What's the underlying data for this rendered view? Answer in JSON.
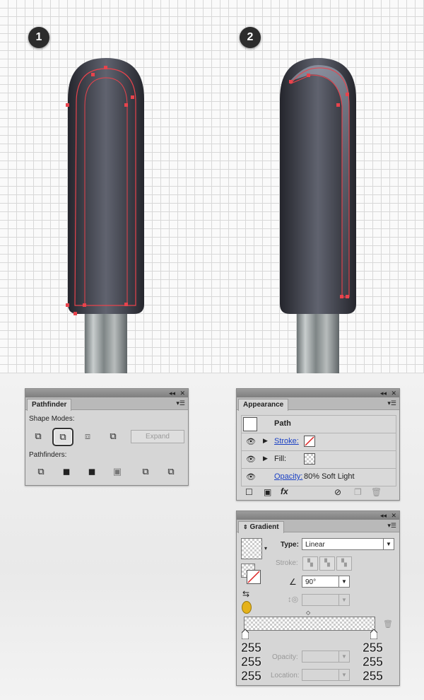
{
  "steps": {
    "step1": "1",
    "step2": "2"
  },
  "pathfinder": {
    "tab": "Pathfinder",
    "shape_modes_label": "Shape Modes:",
    "expand_label": "Expand",
    "pathfinders_label": "Pathfinders:",
    "shape_mode_icons": [
      "unite-icon",
      "minus-front-icon",
      "intersect-icon",
      "exclude-icon"
    ],
    "pathfinder_icons": [
      "divide-icon",
      "trim-icon",
      "merge-icon",
      "crop-icon",
      "outline-icon",
      "minus-back-icon"
    ]
  },
  "appearance": {
    "tab": "Appearance",
    "path_label": "Path",
    "stroke_label": "Stroke:",
    "fill_label": "Fill:",
    "opacity_label": "Opacity:",
    "opacity_value": "80% Soft Light"
  },
  "gradient": {
    "tab": "Gradient",
    "type_label": "Type:",
    "type_value": "Linear",
    "stroke_label": "Stroke:",
    "angle_value": "90°",
    "opacity_label": "Opacity:",
    "location_label": "Location:",
    "left_stop_rgb": [
      "255",
      "255",
      "255"
    ],
    "right_stop_rgb": [
      "255",
      "255",
      "255"
    ]
  },
  "colors": {
    "selection": "#e8434c",
    "handle_dark": "#2b2c34",
    "handle_mid": "#5c5f6d",
    "link": "#1b41c4"
  }
}
